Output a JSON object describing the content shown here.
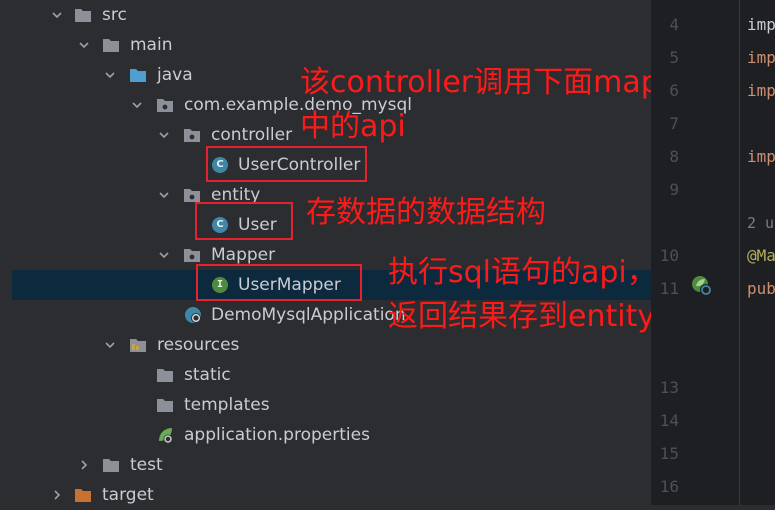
{
  "tree": {
    "items": [
      {
        "label": "src",
        "icon": "folder-icon",
        "expanded": true
      },
      {
        "label": "main",
        "icon": "folder-icon",
        "expanded": true
      },
      {
        "label": "java",
        "icon": "source-folder-icon",
        "expanded": true
      },
      {
        "label": "com.example.demo_mysql",
        "icon": "package-icon",
        "expanded": true
      },
      {
        "label": "controller",
        "icon": "package-icon",
        "expanded": true
      },
      {
        "label": "UserController",
        "icon": "class-icon"
      },
      {
        "label": "entity",
        "icon": "package-icon",
        "expanded": true
      },
      {
        "label": "User",
        "icon": "class-icon"
      },
      {
        "label": "Mapper",
        "icon": "package-icon",
        "expanded": true
      },
      {
        "label": "UserMapper",
        "icon": "interface-icon",
        "selected": true
      },
      {
        "label": "DemoMysqlApplication",
        "icon": "spring-boot-class-icon"
      },
      {
        "label": "resources",
        "icon": "resources-folder-icon",
        "expanded": true
      },
      {
        "label": "static",
        "icon": "folder-icon"
      },
      {
        "label": "templates",
        "icon": "folder-icon"
      },
      {
        "label": "application.properties",
        "icon": "spring-properties-icon"
      },
      {
        "label": "test",
        "icon": "folder-icon",
        "expanded": false
      },
      {
        "label": "target",
        "icon": "excluded-folder-icon",
        "expanded": false
      }
    ],
    "class_badge": "C",
    "interface_badge": "I"
  },
  "annotations": {
    "controller_note_1": "该controller调用下面mapper",
    "controller_note_2": "中的api",
    "entity_note": "存数据的数据结构",
    "mapper_note_1": "执行sql语句的api，",
    "mapper_note_2": "返回结果存到entity"
  },
  "editor": {
    "line_numbers": [
      "4",
      "5",
      "6",
      "7",
      "8",
      "9",
      "10",
      "11",
      "13",
      "14",
      "15",
      "16"
    ],
    "usage_hint": "2 u",
    "code_lines": [
      "imp",
      "imp",
      "imp",
      "imp",
      "@Ma",
      "pub"
    ]
  },
  "colors": {
    "annotation_red": "#e5222d",
    "folder": "#8c9098",
    "source_folder": "#4f9dd1",
    "target_folder": "#c9712f",
    "selection": "#0d293e"
  }
}
